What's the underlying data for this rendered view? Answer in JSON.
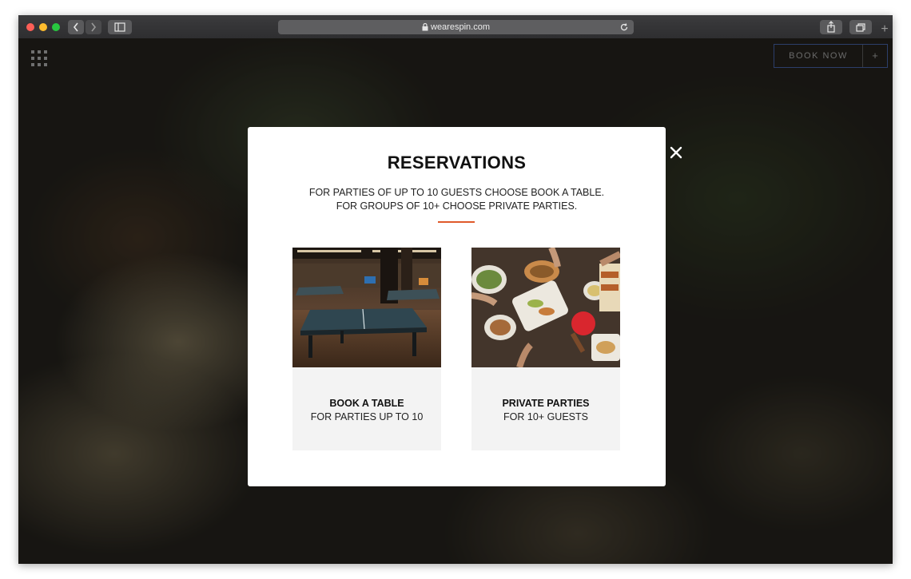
{
  "browser": {
    "url": "wearespin.com",
    "icons": {
      "back": "chevron-left-icon",
      "forward": "chevron-right-icon",
      "sidebar": "sidebar-icon",
      "lock": "lock-icon",
      "reload": "reload-icon",
      "share": "share-icon",
      "tabs": "tabs-icon",
      "new_tab": "plus-icon"
    },
    "new_tab_label": "+"
  },
  "header": {
    "menu_icon": "grid-menu-icon",
    "book_now_label": "BOOK NOW",
    "book_now_plus": "+"
  },
  "modal": {
    "title": "RESERVATIONS",
    "description_line1": "FOR PARTIES OF UP TO 10 GUESTS CHOOSE BOOK A TABLE.",
    "description_line2": "FOR GROUPS OF 10+ CHOOSE PRIVATE PARTIES.",
    "accent_color": "#e05a2b",
    "close_icon": "close-icon",
    "options": [
      {
        "title": "BOOK A TABLE",
        "subtitle": "FOR PARTIES UP TO 10",
        "image": "ping-pong-tables-photo"
      },
      {
        "title": "PRIVATE PARTIES",
        "subtitle": "FOR 10+ GUESTS",
        "image": "food-spread-photo"
      }
    ]
  },
  "colors": {
    "traffic_red": "#fe5f57",
    "traffic_yellow": "#febc2e",
    "traffic_green": "#28c840",
    "book_now_border": "#2c3e6a"
  }
}
